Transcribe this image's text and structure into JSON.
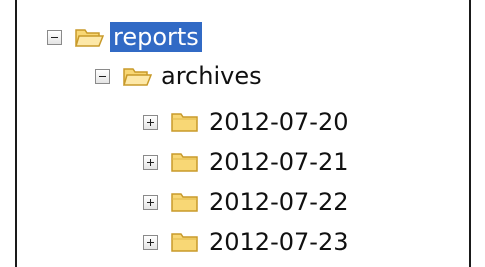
{
  "tree": {
    "root": {
      "label": "reports",
      "expanded": true,
      "selected": true,
      "icon": "folder-open-icon",
      "children": [
        {
          "label": "archives",
          "expanded": true,
          "icon": "folder-open-icon",
          "children": [
            {
              "label": "2012-07-20",
              "expanded": false,
              "icon": "folder-closed-icon"
            },
            {
              "label": "2012-07-21",
              "expanded": false,
              "icon": "folder-closed-icon"
            },
            {
              "label": "2012-07-22",
              "expanded": false,
              "icon": "folder-closed-icon"
            },
            {
              "label": "2012-07-23",
              "expanded": false,
              "icon": "folder-closed-icon"
            }
          ]
        }
      ]
    }
  },
  "colors": {
    "selection_background": "#316ac5",
    "folder_fill": "#f8d775",
    "folder_outline": "#c89a2a"
  }
}
